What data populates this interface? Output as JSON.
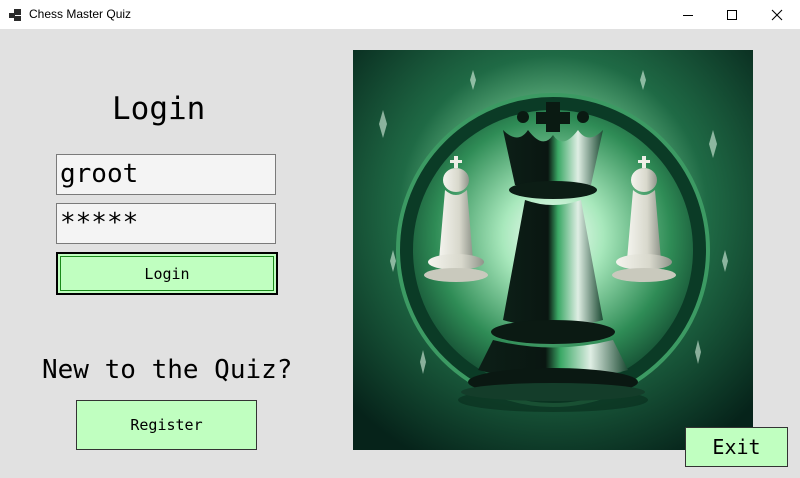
{
  "window": {
    "title": "Chess Master Quiz",
    "controls": [
      "minimize-icon",
      "maximize-icon",
      "close-icon"
    ]
  },
  "login": {
    "title": "Login",
    "username_value": "groot",
    "password_value": "*****",
    "button_label": "Login"
  },
  "register": {
    "prompt": "New to the Quiz?",
    "button_label": "Register"
  },
  "exit": {
    "button_label": "Exit"
  },
  "image": {
    "subject": "chess-king-artwork"
  },
  "colors": {
    "button_bg": "#c0ffc0",
    "client_bg": "#e1e1e1",
    "art_dark": "#0a2a1e",
    "art_green": "#2e8a52"
  }
}
